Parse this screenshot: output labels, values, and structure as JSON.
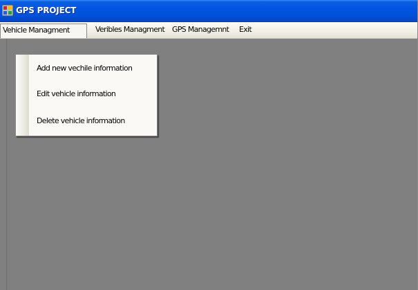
{
  "window": {
    "title": "GPS PROJECT"
  },
  "menubar": {
    "items": [
      {
        "label": "Vehicle Managment"
      },
      {
        "label": "Veribles Managment"
      },
      {
        "label": "GPS Managemnt"
      },
      {
        "label": "Exit"
      }
    ]
  },
  "dropdown": {
    "parent": "Vehicle Managment",
    "items": [
      {
        "label": "Add new vechile information"
      },
      {
        "label": "Edit vehicle information"
      },
      {
        "label": "Delete vehicle information"
      }
    ]
  },
  "colors": {
    "titlebar": "#0054e3",
    "menubar": "#f1efe6",
    "client_area": "#808080"
  }
}
